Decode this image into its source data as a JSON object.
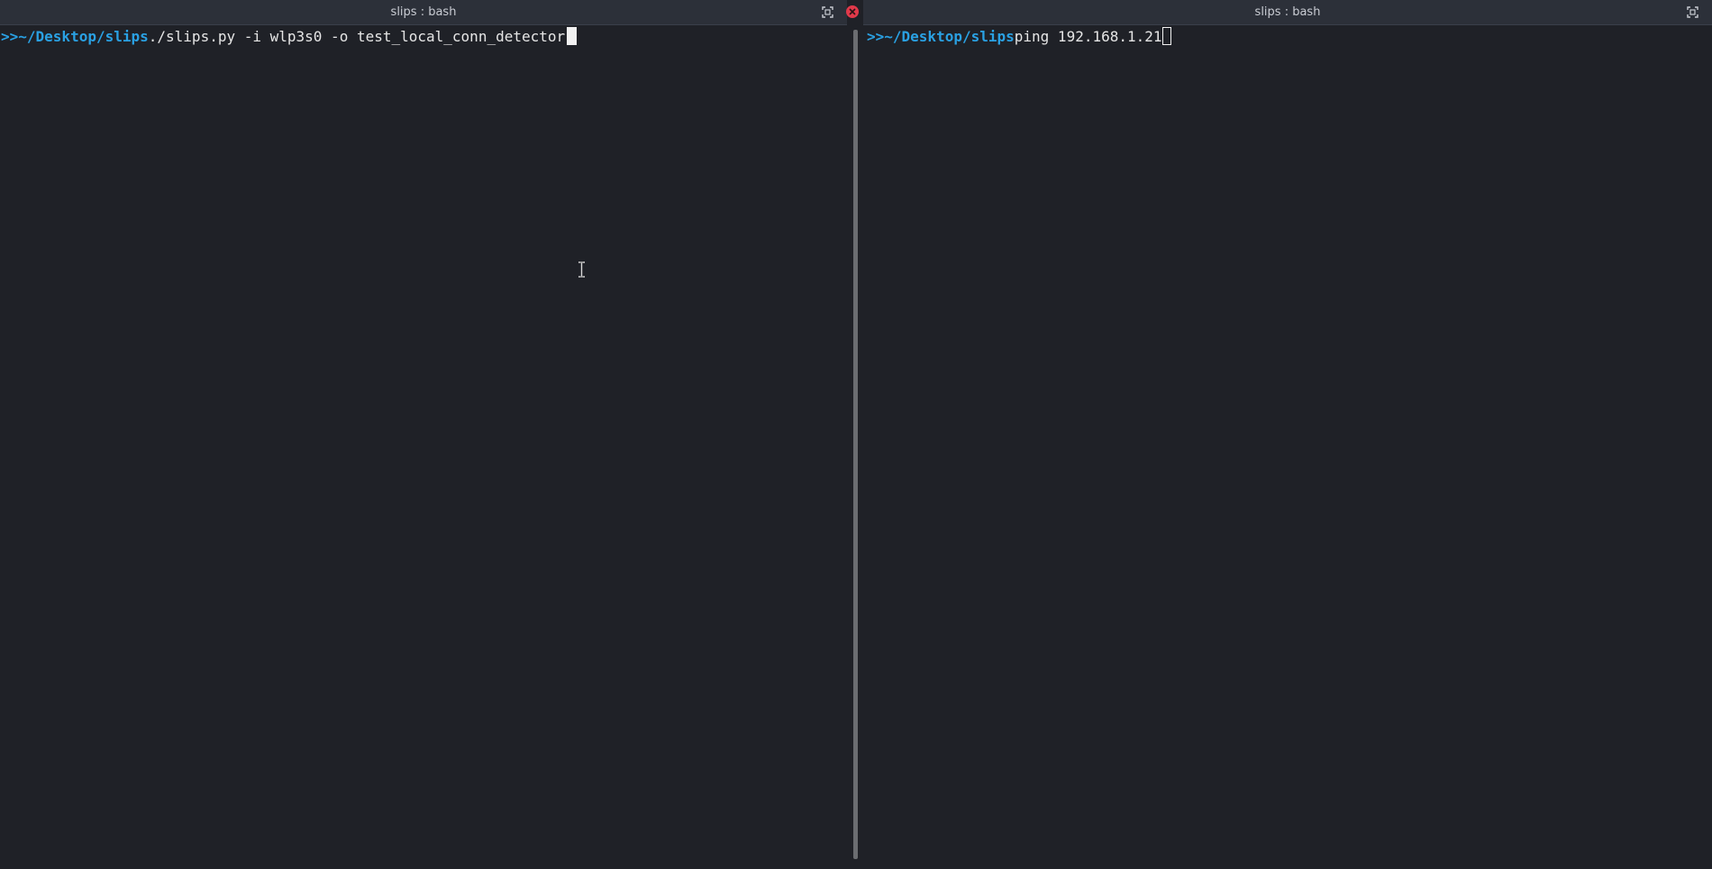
{
  "panes": [
    {
      "title": "slips : bash",
      "prompt_arrow": ">>",
      "prompt_path": "~/Desktop/slips",
      "command": "./slips.py -i wlp3s0 -o test_local_conn_detector ",
      "cursor": "block"
    },
    {
      "title": "slips : bash",
      "prompt_arrow": ">>",
      "prompt_path": "~/Desktop/slips",
      "command": "ping 192.168.1.21",
      "cursor": "hollow"
    }
  ],
  "icons": {
    "maximize": "maximize-icon",
    "close": "close-icon",
    "text_cursor": "ibeam-cursor-icon"
  },
  "colors": {
    "background": "#1f2127",
    "titlebar": "#2c3039",
    "prompt": "#2aa1e3",
    "text": "#e6e6e6",
    "close": "#e0394a"
  }
}
